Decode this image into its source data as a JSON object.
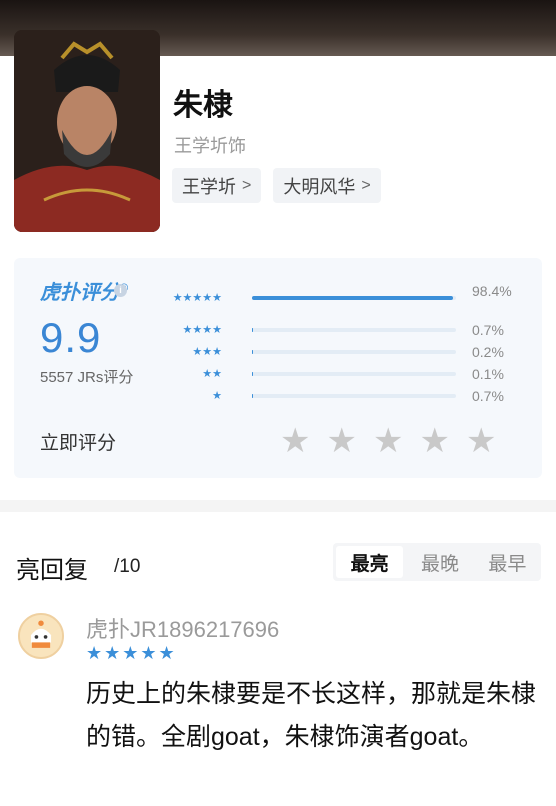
{
  "character": {
    "name": "朱棣",
    "actor_credit": "王学圻饰",
    "tags": [
      {
        "label": "王学圻",
        "chevron": ">"
      },
      {
        "label": "大明风华",
        "chevron": ">"
      }
    ]
  },
  "rating": {
    "logo_text": "虎扑评分",
    "logo_mark": "®",
    "info_icon": "i",
    "score": "9.9",
    "count_label": "5557 JRs评分",
    "rate_now_label": "立即评分",
    "distribution": [
      {
        "stars": "★★★★★",
        "percent_label": "98.4%",
        "fraction": 0.984
      },
      {
        "stars": "★★★★",
        "percent_label": "0.7%",
        "fraction": 0.007
      },
      {
        "stars": "★★★",
        "percent_label": "0.2%",
        "fraction": 0.002
      },
      {
        "stars": "★★",
        "percent_label": "0.1%",
        "fraction": 0.001
      },
      {
        "stars": "★",
        "percent_label": "0.7%",
        "fraction": 0.007
      }
    ],
    "input_stars": [
      "★",
      "★",
      "★",
      "★",
      "★"
    ],
    "accent_color": "#3b8fd9"
  },
  "comments": {
    "title": "亮回复",
    "count": "/10",
    "sort_options": [
      "最亮",
      "最晚",
      "最早"
    ],
    "selected_sort": "最亮",
    "items": [
      {
        "username": "虎扑JR1896217696",
        "stars": "★★★★★",
        "text": "历史上的朱棣要是不长这样，那就是朱棣的错。全剧goat，朱棣饰演者goat。"
      }
    ]
  }
}
